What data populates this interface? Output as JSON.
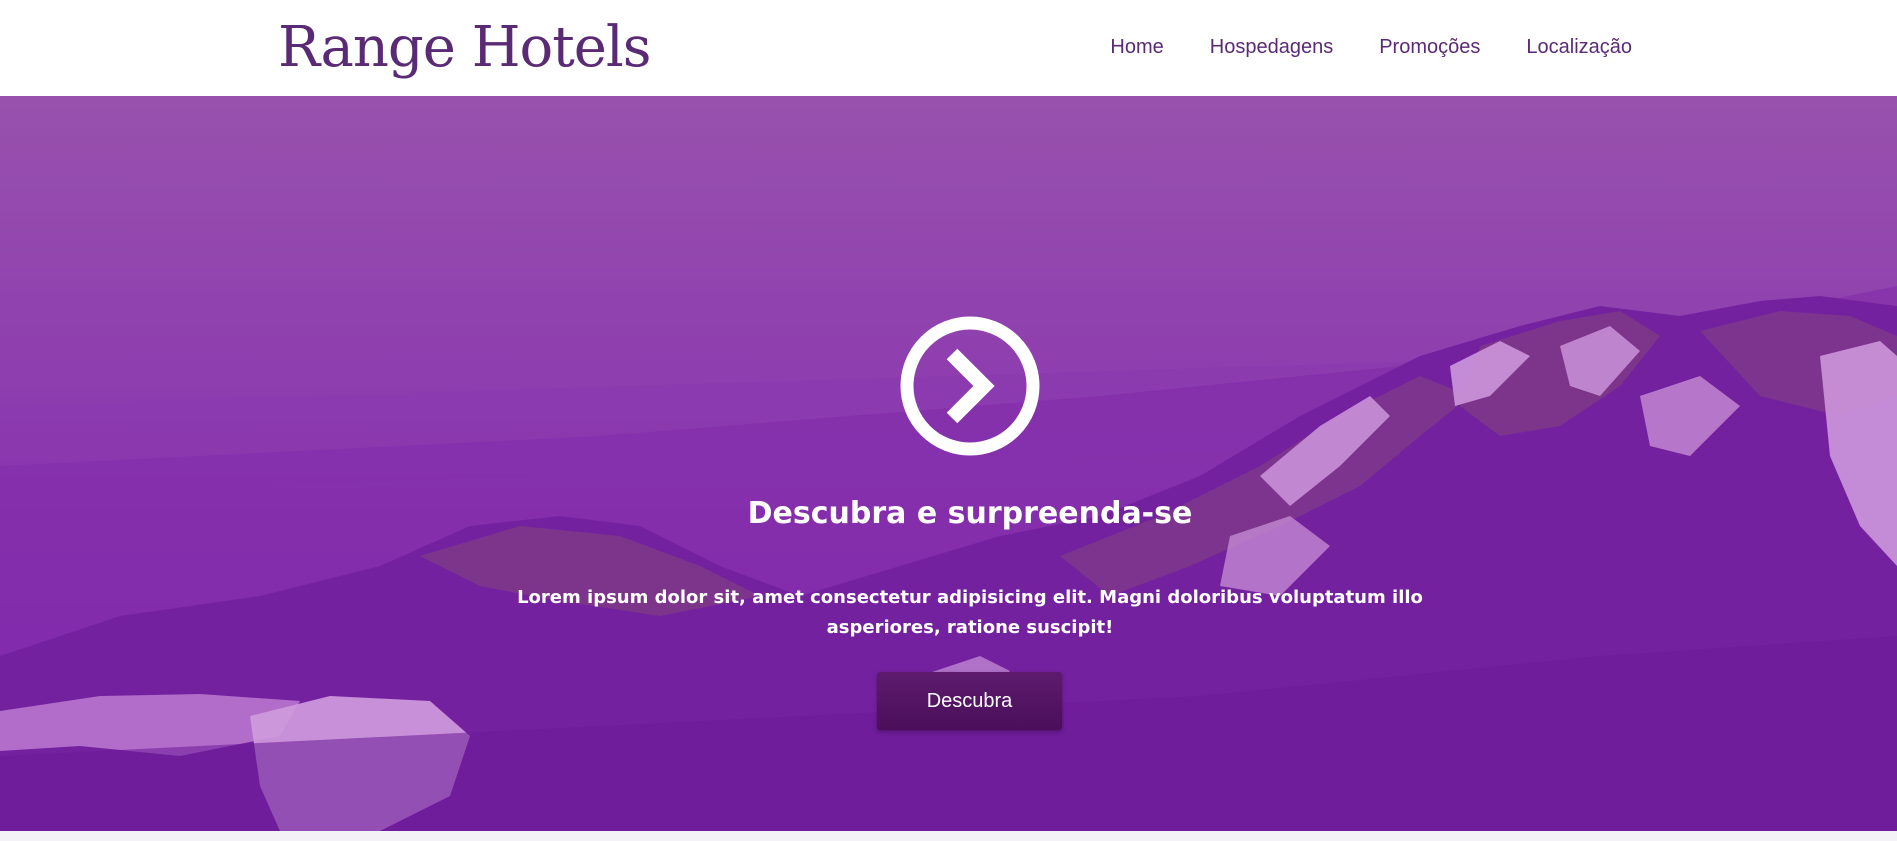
{
  "header": {
    "logo_text": "Range Hotels",
    "nav": [
      {
        "label": "Home"
      },
      {
        "label": "Hospedagens"
      },
      {
        "label": "Promoções"
      },
      {
        "label": "Localização"
      }
    ]
  },
  "hero": {
    "icon": "chevron-right-circle-icon",
    "title": "Descubra e surpreenda-se",
    "text": "Lorem ipsum dolor sit, amet consectetur adipisicing elit. Magni doloribus voluptatum illo asperiores, ratione suscipit!",
    "button_label": "Descubra"
  },
  "colors": {
    "brand": "#5b2a74",
    "hero_overlay": "#8d3eac",
    "button": "#4a0f5a"
  }
}
